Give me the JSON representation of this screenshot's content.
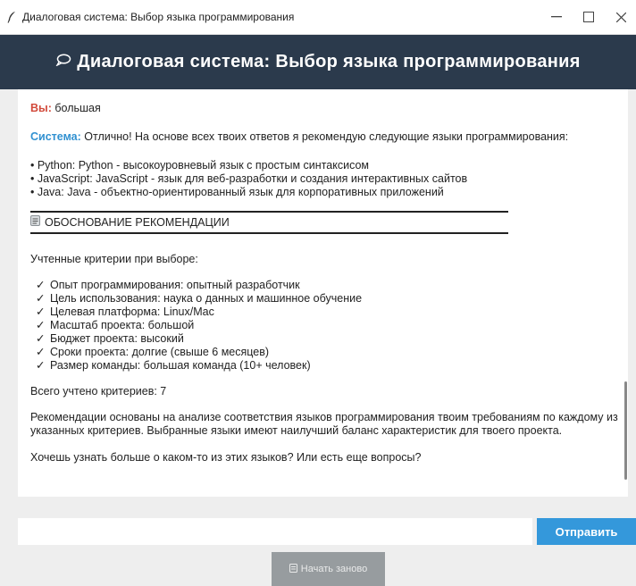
{
  "window": {
    "title": "Диалоговая система: Выбор языка программирования",
    "icon": "feather-icon"
  },
  "header": {
    "title": "Диалоговая система: Выбор языка программирования",
    "icon": "speech-bubble-icon",
    "bg_color": "#2b3a4c"
  },
  "chat": {
    "user_label": "Вы:",
    "user_message": "большая",
    "system_label": "Система:",
    "system_message": "Отлично! На основе всех твоих ответов я рекомендую следующие языки программирования:",
    "languages": [
      "• Python: Python - высокоуровневый язык с простым синтаксисом",
      "• JavaScript: JavaScript - язык для веб-разработки и создания интерактивных сайтов",
      "• Java: Java - объектно-ориентированный язык для корпоративных приложений"
    ],
    "section_title": "ОБОСНОВАНИЕ РЕКОМЕНДАЦИИ",
    "section_icon": "document-icon",
    "criteria_intro": "Учтенные критерии при выборе:",
    "check_mark": "✓",
    "criteria": [
      "Опыт программирования: опытный разработчик",
      "Цель использования: наука о данных и машинное обучение",
      "Целевая платформа: Linux/Mac",
      "Масштаб проекта: большой",
      "Бюджет проекта: высокий",
      "Сроки проекта: долгие (свыше 6 месяцев)",
      "Размер команды: большая команда (10+ человек)"
    ],
    "total": "Всего учтено критериев: 7",
    "explanation": "Рекомендации основаны на анализе соответствия языков программирования твоим требованиям по каждому из указанных критериев. Выбранные языки имеют наилучший баланс характеристик для твоего проекта.",
    "followup": "Хочешь узнать больше о каком-то из этих языков? Или есть еще вопросы?",
    "user_label_color": "#d24a3b",
    "system_label_color": "#3191d1"
  },
  "input": {
    "value": "",
    "placeholder": ""
  },
  "buttons": {
    "send": "Отправить",
    "send_color": "#3498db",
    "restart": "Начать заново",
    "restart_icon": "document-icon"
  }
}
